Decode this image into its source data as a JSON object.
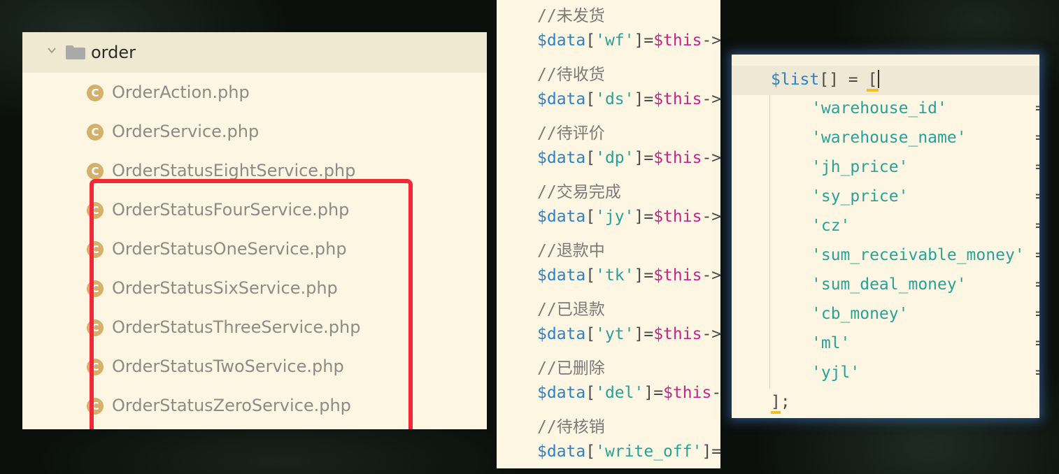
{
  "tree": {
    "folder": "order",
    "files": [
      "OrderAction.php",
      "OrderService.php",
      "OrderStatusEightService.php",
      "OrderStatusFourService.php",
      "OrderStatusOneService.php",
      "OrderStatusSixService.php",
      "OrderStatusThreeService.php",
      "OrderStatusTwoService.php",
      "OrderStatusZeroService.php"
    ],
    "file_icon_letter": "C",
    "highlight_color": "#f12838"
  },
  "code_mid": {
    "lines": [
      {
        "comment": "//未发货"
      },
      {
        "var": "$data",
        "key": "'wf'",
        "rest": "]=",
        "this": "$this",
        "tail": "->"
      },
      {
        "comment": "//待收货"
      },
      {
        "var": "$data",
        "key": "'ds'",
        "rest": "]=",
        "this": "$this",
        "tail": "->"
      },
      {
        "comment": "//待评价"
      },
      {
        "var": "$data",
        "key": "'dp'",
        "rest": "]=",
        "this": "$this",
        "tail": "->"
      },
      {
        "comment": "//交易完成"
      },
      {
        "var": "$data",
        "key": "'jy'",
        "rest": "]=",
        "this": "$this",
        "tail": "->"
      },
      {
        "comment": "//退款中"
      },
      {
        "var": "$data",
        "key": "'tk'",
        "rest": "]=",
        "this": "$this",
        "tail": "->"
      },
      {
        "comment": "//已退款"
      },
      {
        "var": "$data",
        "key": "'yt'",
        "rest": "]=",
        "this": "$this",
        "tail": "->"
      },
      {
        "comment": "//已删除"
      },
      {
        "var": "$data",
        "key": "'del'",
        "rest": "]=",
        "this": "$this",
        "tail": "-"
      },
      {
        "comment": "//待核销"
      },
      {
        "var": "$data",
        "key": "'write_off'",
        "rest": "]=",
        "this": "",
        "tail": ""
      }
    ]
  },
  "code_right": {
    "first_var": "$list",
    "first_rest": "[] = ",
    "open_bracket": "[",
    "keys": [
      "'warehouse_id'",
      "'warehouse_name'",
      "'jh_price'",
      "'sy_price'",
      "'cz'",
      "'sum_receivable_money'",
      "'sum_deal_money'",
      "'cb_money'",
      "'ml'",
      "'yjl'"
    ],
    "eq": "=",
    "close_bracket": "]",
    "semicolon": ";"
  },
  "colors": {
    "panel_bg": "#fdf6e3",
    "variable": "#2f80c6",
    "string": "#2aa198",
    "this_keyword": "#c7248a",
    "comment": "#7a7a7a",
    "file_text": "#8c8c86"
  }
}
